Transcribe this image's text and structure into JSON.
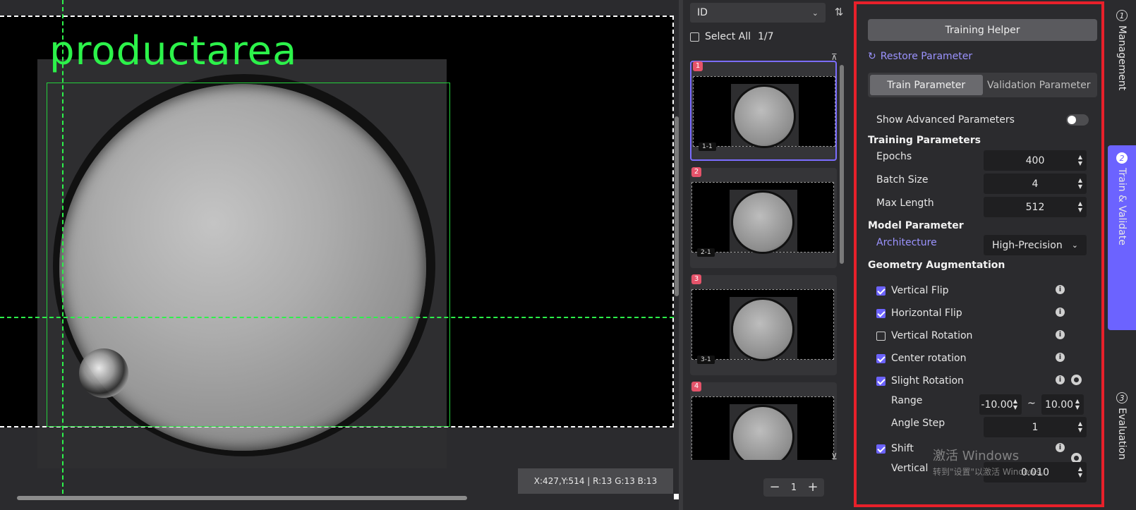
{
  "canvas": {
    "overlay_label": "productarea",
    "coord_readout": "X:427,Y:514 | R:13 G:13 B:13"
  },
  "thumbnails": {
    "sort_value": "ID",
    "select_all_label": "Select All",
    "count": "1/7",
    "items": [
      {
        "num": "1",
        "tag": "1-1"
      },
      {
        "num": "2",
        "tag": "2-1"
      },
      {
        "num": "3",
        "tag": "3-1"
      },
      {
        "num": "4",
        "tag": ""
      }
    ],
    "page": "1"
  },
  "panel": {
    "training_helper": "Training Helper",
    "restore": "Restore Parameter",
    "tab_train": "Train Parameter",
    "tab_validation": "Validation Parameter",
    "show_advanced": "Show Advanced Parameters",
    "training_params_heading": "Training Parameters",
    "epochs_label": "Epochs",
    "epochs_value": "400",
    "batch_label": "Batch Size",
    "batch_value": "4",
    "maxlen_label": "Max Length",
    "maxlen_value": "512",
    "model_heading": "Model Parameter",
    "arch_label": "Architecture",
    "arch_value": "High-Precision",
    "geo_heading": "Geometry Augmentation",
    "aug": {
      "vertical_flip": "Vertical Flip",
      "horizontal_flip": "Horizontal Flip",
      "vertical_rotation": "Vertical Rotation",
      "center_rotation": "Center rotation",
      "slight_rotation": "Slight Rotation",
      "shift": "Shift"
    },
    "range_label": "Range",
    "range_min": "-10.00",
    "range_sep": "~",
    "range_max": "10.00",
    "angle_step_label": "Angle Step",
    "angle_step_value": "1",
    "vertical_label": "Vertical",
    "vertical_value": "0.010",
    "watermark_title": "激活 Windows",
    "watermark_sub": "转到\"设置\"以激活 Windows。"
  },
  "steps": [
    {
      "num": "1",
      "label": "Management"
    },
    {
      "num": "2",
      "label": "Train & Validate"
    },
    {
      "num": "3",
      "label": "Evaluation"
    }
  ],
  "colors": {
    "accent": "#6c63ff",
    "highlight_border": "#e8202a",
    "guide_green": "#2cf24a"
  }
}
